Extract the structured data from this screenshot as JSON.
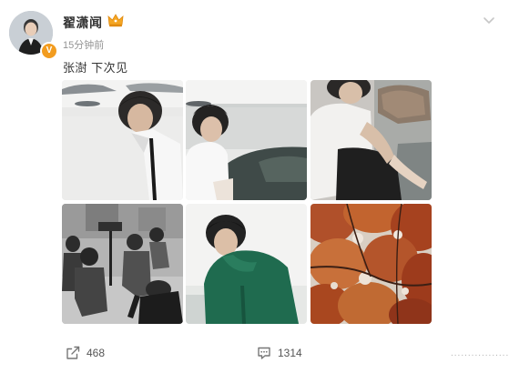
{
  "post": {
    "author": {
      "name": "翟潇闻",
      "badge": "V",
      "badge_color": "#f29c1f"
    },
    "timestamp": "15分钟前",
    "text": "张澍 下次见"
  },
  "photos": [
    {
      "subject": "boy on beach rocks, white shirt"
    },
    {
      "subject": "boy sitting by sea, white t-shirt"
    },
    {
      "subject": "boy in white shirt sitting"
    },
    {
      "subject": "behind the scenes film crew, black and white"
    },
    {
      "subject": "boy in green hoodie"
    },
    {
      "subject": "autumn red maple leaves"
    }
  ],
  "actions": {
    "share_count": "468",
    "comment_count": "1314",
    "like_count": "...................."
  },
  "colors": {
    "text_primary": "#333333",
    "text_muted": "#939393",
    "crown": "#f5a623"
  }
}
